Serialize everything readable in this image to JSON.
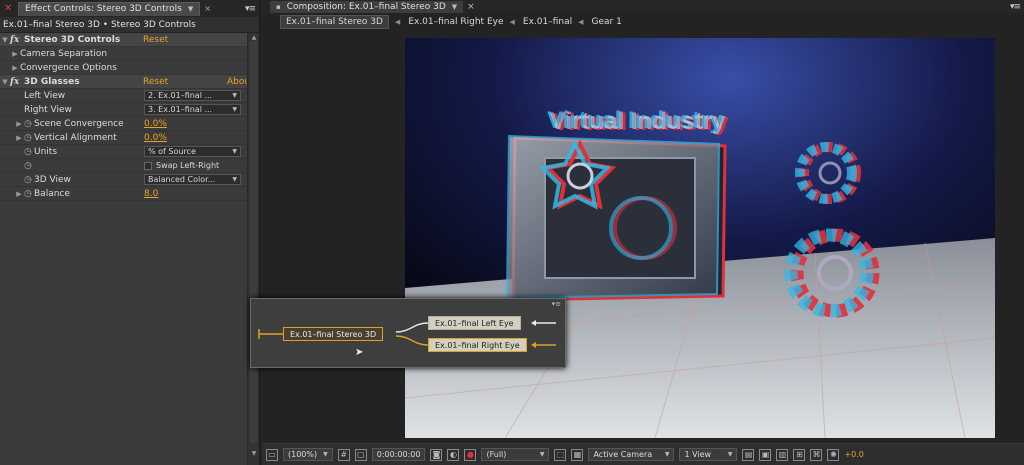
{
  "effect_controls": {
    "tab_title": "Effect Controls: Stereo 3D Controls",
    "breadcrumb": "Ex.01–final Stereo 3D • Stereo 3D Controls",
    "rows": [
      {
        "kind": "effect",
        "label": "Stereo 3D Controls",
        "reset": "Reset"
      },
      {
        "kind": "group",
        "label": "Camera Separation"
      },
      {
        "kind": "group",
        "label": "Convergence Options"
      },
      {
        "kind": "effect",
        "label": "3D Glasses",
        "reset": "Reset",
        "about": "Abou"
      },
      {
        "kind": "dropdown",
        "label": "Left View",
        "value": "2. Ex.01–final ..."
      },
      {
        "kind": "dropdown",
        "label": "Right View",
        "value": "3. Ex.01–final ..."
      },
      {
        "kind": "value",
        "label": "Scene Convergence",
        "value": "0.0%"
      },
      {
        "kind": "value",
        "label": "Vertical Alignment",
        "value": "0.0%"
      },
      {
        "kind": "dropdown",
        "label": "Units",
        "value": "% of Source"
      },
      {
        "kind": "checkbox",
        "label": "",
        "value": "Swap Left-Right"
      },
      {
        "kind": "dropdown",
        "label": "3D View",
        "value": "Balanced Color..."
      },
      {
        "kind": "value",
        "label": "Balance",
        "value": "8.0"
      }
    ]
  },
  "composition": {
    "tab_title": "Composition: Ex.01–final Stereo 3D",
    "breadcrumbs": [
      "Ex.01–final Stereo 3D",
      "Ex.01–final Right Eye",
      "Ex.01–final",
      "Gear 1"
    ],
    "scene_title": "Virtual Industry",
    "flowchart": {
      "main": "Ex.01–final Stereo 3D",
      "left": "Ex.01–final Left Eye",
      "right": "Ex.01–final Right Eye"
    },
    "toolbar": {
      "zoom": "(100%)",
      "timecode": "0:00:00:00",
      "resolution": "(Full)",
      "camera": "Active Camera",
      "views": "1 View",
      "exposure": "+0.0"
    }
  },
  "colors": {
    "accent": "#e6a32a",
    "stereo_red": "#e0303a",
    "stereo_cyan": "#30b8e8"
  },
  "icons": [
    "close-icon",
    "panel-menu-icon",
    "stopwatch-icon",
    "fx-icon",
    "camera-icon",
    "grid-icon",
    "region-icon",
    "color-channel-icon"
  ]
}
